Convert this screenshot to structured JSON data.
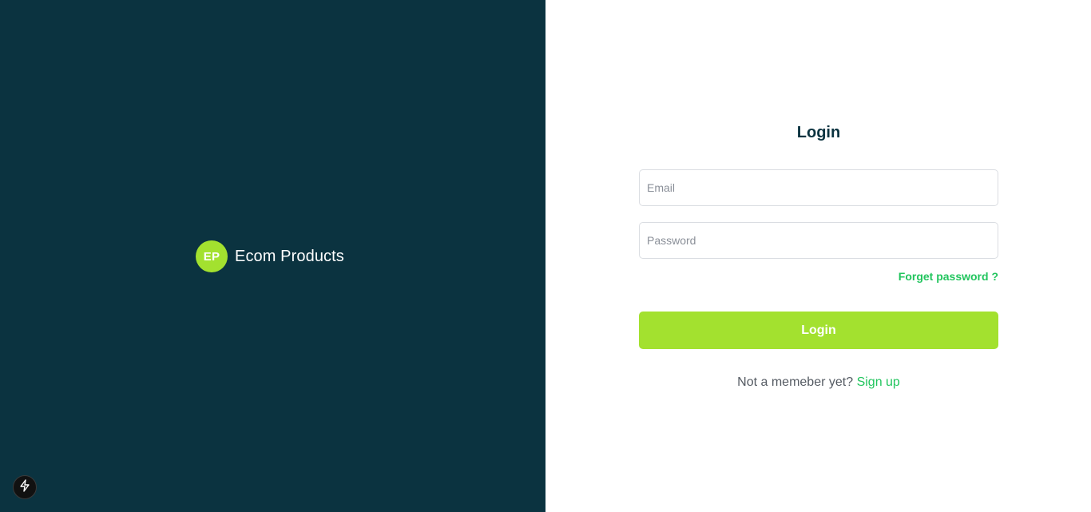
{
  "brand": {
    "badge_text": "EP",
    "name": "Ecom Products"
  },
  "login_form": {
    "title": "Login",
    "email_placeholder": "Email",
    "password_placeholder": "Password",
    "forgot_password_label": "Forget password ?",
    "submit_label": "Login",
    "signup_prompt": "Not a memeber yet?",
    "signup_link_label": "Sign up"
  },
  "dev_indicator": {
    "icon": "lightning-bolt-icon"
  },
  "colors": {
    "brand_panel_bg": "#0b3340",
    "accent_lime": "#a3e12f",
    "link_green": "#22c55e",
    "title_text": "#0b3340"
  }
}
